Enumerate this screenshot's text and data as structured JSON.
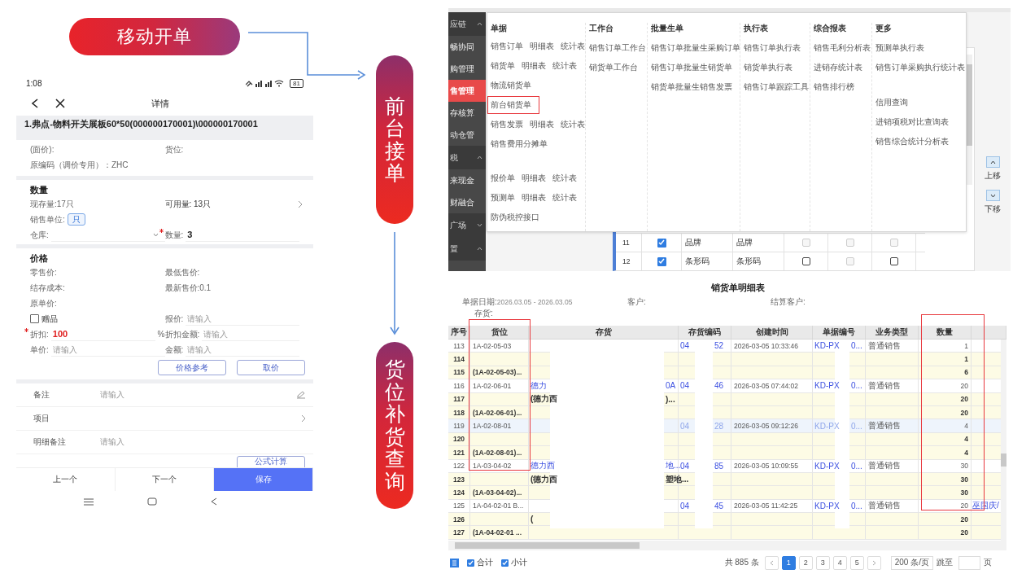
{
  "banner": {
    "title": "移动开单"
  },
  "pills": [
    {
      "text": "前台接单"
    },
    {
      "text": "货位补货查询"
    }
  ],
  "phone": {
    "status_bar": {
      "time": "1:08",
      "battery": "81"
    },
    "nav": {
      "title": "详情"
    },
    "product_title": "1.弗点-物料开关展板60*50(000000170001)\\000000170001",
    "info_rows": [
      {
        "cells": [
          {
            "kind": "text",
            "label": "(面价):"
          },
          {
            "kind": "text",
            "label": "货位:"
          }
        ]
      },
      {
        "cells": [
          {
            "kind": "text",
            "label": "原编码（调价专用）：",
            "value": "ZHC"
          }
        ]
      }
    ],
    "sections": [
      {
        "title": "数量",
        "rows": [
          {
            "cells": [
              {
                "kind": "text",
                "label": "现存量:",
                "value": "17只"
              },
              {
                "kind": "link",
                "label": "可用量:",
                "value": "13只"
              }
            ]
          },
          {
            "cells": [
              {
                "kind": "chip",
                "label": "销售单位:",
                "value": "只"
              }
            ]
          },
          {
            "cells": [
              {
                "kind": "select",
                "label": "仓库:"
              },
              {
                "kind": "input",
                "label": "数量:",
                "value": "3",
                "required": true
              }
            ]
          }
        ]
      },
      {
        "title": "价格",
        "rows": [
          {
            "cells": [
              {
                "kind": "text",
                "label": "零售价:"
              },
              {
                "kind": "text",
                "label": "最低售价:"
              }
            ]
          },
          {
            "cells": [
              {
                "kind": "text",
                "label": "结存成本:"
              },
              {
                "kind": "text",
                "label": "最新售价:",
                "value": "0.1"
              }
            ]
          },
          {
            "cells": [
              {
                "kind": "text",
                "label": "原单价:"
              }
            ]
          },
          {
            "cells": [
              {
                "kind": "checkbox",
                "label": "赠品",
                "checked": false
              },
              {
                "kind": "input",
                "label": "报价:",
                "placeholder": "请输入",
                "required": false
              }
            ]
          },
          {
            "cells": [
              {
                "kind": "input",
                "label": "折扣:",
                "value": "100",
                "suffix": "%",
                "required": true,
                "color": "#e02020"
              },
              {
                "kind": "input",
                "label": "折扣金额:",
                "placeholder": "请输入",
                "required": false
              }
            ]
          },
          {
            "cells": [
              {
                "kind": "input",
                "label": "单价:",
                "placeholder": "请输入",
                "required": false
              },
              {
                "kind": "input",
                "label": "金额:",
                "placeholder": "请输入",
                "required": false
              }
            ]
          }
        ],
        "buttons": [
          "价格参考",
          "取价"
        ]
      }
    ],
    "list_rows": [
      {
        "kind": "note",
        "label": "备注",
        "placeholder": "请输入"
      },
      {
        "kind": "picker",
        "label": "项目"
      },
      {
        "kind": "text",
        "label": "明细备注",
        "placeholder": "请输入"
      }
    ],
    "formula_button": "公式计算",
    "bottom_buttons": [
      {
        "label": "上一个",
        "primary": false
      },
      {
        "label": "下一个",
        "primary": false
      },
      {
        "label": "保存",
        "primary": true
      }
    ]
  },
  "erp_menu": {
    "sidebar": [
      {
        "label": "应链",
        "kind": "group",
        "expanded": true,
        "selected": false
      },
      {
        "label": "畅协同",
        "kind": "item",
        "selected": false
      },
      {
        "label": "购管理",
        "kind": "item",
        "selected": false
      },
      {
        "label": "售管理",
        "kind": "item",
        "selected": true
      },
      {
        "label": "存核算",
        "kind": "item",
        "selected": false
      },
      {
        "label": "动仓管",
        "kind": "item",
        "selected": false
      },
      {
        "label": "税",
        "kind": "group",
        "expanded": true,
        "selected": false
      },
      {
        "label": "来现金",
        "kind": "item",
        "selected": false
      },
      {
        "label": "财融合",
        "kind": "item",
        "selected": false
      },
      {
        "label": "广场",
        "kind": "group",
        "expanded": false,
        "selected": false
      },
      {
        "label": "置",
        "kind": "group",
        "expanded": true,
        "selected": false
      }
    ],
    "columns": [
      {
        "title": "单据",
        "rows": [
          {
            "kind": "items",
            "items": [
              "销售订单",
              "明细表",
              "统计表"
            ],
            "boxed": false
          },
          {
            "kind": "items",
            "items": [
              "销货单",
              "明细表",
              "统计表"
            ],
            "boxed": false
          },
          {
            "kind": "items",
            "items": [
              "物流销货单"
            ],
            "boxed": false
          },
          {
            "kind": "items",
            "items": [
              "前台销货单"
            ],
            "boxed": true
          },
          {
            "kind": "items",
            "items": [
              "销售发票",
              "明细表",
              "统计表"
            ],
            "boxed": false
          },
          {
            "kind": "items",
            "items": [
              "销售费用分摊单"
            ],
            "boxed": false
          },
          {
            "kind": "gap"
          },
          {
            "kind": "items",
            "items": [
              "报价单",
              "明细表",
              "统计表"
            ],
            "boxed": false
          },
          {
            "kind": "items",
            "items": [
              "预测单",
              "明细表",
              "统计表"
            ],
            "boxed": false
          },
          {
            "kind": "items",
            "items": [
              "防伪税控接口"
            ],
            "boxed": false
          }
        ]
      },
      {
        "title": "工作台",
        "rows": [
          {
            "kind": "items",
            "items": [
              "销售订单工作台"
            ],
            "boxed": false
          },
          {
            "kind": "items",
            "items": [
              "销货单工作台"
            ],
            "boxed": false
          }
        ]
      },
      {
        "title": "批量生单",
        "rows": [
          {
            "kind": "items",
            "items": [
              "销售订单批量生采购订单"
            ],
            "boxed": false
          },
          {
            "kind": "items",
            "items": [
              "销售订单批量生销货单"
            ],
            "boxed": false
          },
          {
            "kind": "items",
            "items": [
              "销货单批量生销售发票"
            ],
            "boxed": false
          }
        ]
      },
      {
        "title": "执行表",
        "rows": [
          {
            "kind": "items",
            "items": [
              "销售订单执行表"
            ],
            "boxed": false
          },
          {
            "kind": "items",
            "items": [
              "销货单执行表"
            ],
            "boxed": false
          },
          {
            "kind": "items",
            "items": [
              "销售订单跟踪工具"
            ],
            "boxed": false
          }
        ]
      },
      {
        "title": "综合报表",
        "rows": [
          {
            "kind": "items",
            "items": [
              "销售毛利分析表"
            ],
            "boxed": false
          },
          {
            "kind": "items",
            "items": [
              "进销存统计表"
            ],
            "boxed": false
          },
          {
            "kind": "items",
            "items": [
              "销售排行榜"
            ],
            "boxed": false
          }
        ]
      },
      {
        "title": "更多",
        "rows": [
          {
            "kind": "items",
            "items": [
              "预测单执行表"
            ],
            "boxed": false
          },
          {
            "kind": "items",
            "items": [
              "销售订单采购执行统计表"
            ],
            "boxed": false
          },
          {
            "kind": "gap"
          },
          {
            "kind": "items",
            "items": [
              "信用查询"
            ],
            "boxed": false
          },
          {
            "kind": "items",
            "items": [
              "进销项税对比查询表"
            ],
            "boxed": false
          },
          {
            "kind": "items",
            "items": [
              "销售综合统计分析表"
            ],
            "boxed": false
          }
        ]
      }
    ],
    "field_rows": [
      {
        "no": "11",
        "checked": true,
        "name": "品牌",
        "alias": "品牌",
        "flags": [
          {
            "checked": false,
            "disabled": true
          },
          {
            "checked": false,
            "disabled": true
          },
          {
            "checked": false,
            "disabled": true
          }
        ]
      },
      {
        "no": "12",
        "checked": true,
        "name": "条形码",
        "alias": "条形码",
        "flags": [
          {
            "checked": false,
            "disabled": false
          },
          {
            "checked": false,
            "disabled": true
          },
          {
            "checked": false,
            "disabled": false
          }
        ]
      }
    ],
    "move_buttons": [
      "上移",
      "下移"
    ]
  },
  "report": {
    "title": "销货单明细表",
    "filters": [
      {
        "label": "单据日期:",
        "value": "2026.03.05 - 2026.03.05"
      },
      {
        "label": "客户:"
      },
      {
        "label": "结算客户:"
      },
      {
        "label": "存货:"
      }
    ],
    "columns": [
      "序号",
      "货位",
      "存货",
      "存货编码",
      "创建时间",
      "单据编号",
      "业务类型",
      "数量"
    ],
    "rows": [
      {
        "no": "113",
        "kind": "detail",
        "selected": false,
        "location": "1A-02-05-03",
        "code": [
          "04",
          "52"
        ],
        "created": "2026-03-05 10:33:46",
        "doc": [
          "KD-PX",
          "0..."
        ],
        "type": "普通销售",
        "qty": "1"
      },
      {
        "no": "114",
        "kind": "subtotal",
        "selected": false,
        "qty": "1"
      },
      {
        "no": "115",
        "kind": "subtotal",
        "selected": false,
        "location": "(1A-02-05-03)...",
        "qty": "6"
      },
      {
        "no": "116",
        "kind": "detail",
        "selected": false,
        "location": "1A-02-06-01",
        "item": [
          "德力",
          "0A"
        ],
        "code": [
          "04",
          "46"
        ],
        "created": "2026-03-05 07:44:02",
        "doc": [
          "KD-PX",
          "0..."
        ],
        "type": "普通销售",
        "qty": "20"
      },
      {
        "no": "117",
        "kind": "subtotal",
        "selected": false,
        "item": [
          "(德力西",
          ")..."
        ],
        "qty": "20"
      },
      {
        "no": "118",
        "kind": "subtotal",
        "selected": false,
        "location": "(1A-02-06-01)...",
        "qty": "20"
      },
      {
        "no": "119",
        "kind": "detail",
        "selected": true,
        "location": "1A-02-08-01",
        "code": [
          "04",
          "28"
        ],
        "created": "2026-03-05 09:12:26",
        "doc": [
          "KD-PX",
          "0..."
        ],
        "type": "普通销售",
        "qty": "4"
      },
      {
        "no": "120",
        "kind": "subtotal",
        "selected": false,
        "qty": "4"
      },
      {
        "no": "121",
        "kind": "subtotal",
        "selected": false,
        "location": "(1A-02-08-01)...",
        "qty": "4"
      },
      {
        "no": "122",
        "kind": "detail",
        "selected": false,
        "location": "1A-03-04-02",
        "item": [
          "德力西",
          "地..."
        ],
        "code": [
          "04",
          "85"
        ],
        "created": "2026-03-05 10:09:55",
        "doc": [
          "KD-PX",
          "0..."
        ],
        "type": "普通销售",
        "qty": "30"
      },
      {
        "no": "123",
        "kind": "subtotal",
        "selected": false,
        "item": [
          "(德力西",
          "塑地..."
        ],
        "qty": "30"
      },
      {
        "no": "124",
        "kind": "subtotal",
        "selected": false,
        "location": "(1A-03-04-02)...",
        "qty": "30"
      },
      {
        "no": "125",
        "kind": "detail",
        "selected": false,
        "location": "1A-04-02-01 B...",
        "code": [
          "04",
          "45"
        ],
        "created": "2026-03-05 11:42:25",
        "doc": [
          "KD-PX",
          "0..."
        ],
        "type": "普通销售",
        "qty": "20",
        "extra": "巫国庆/"
      },
      {
        "no": "126",
        "kind": "subtotal",
        "selected": false,
        "item": [
          "("
        ],
        "qty": "20"
      },
      {
        "no": "127",
        "kind": "subtotal",
        "selected": false,
        "location": "(1A-04-02-01 ...",
        "qty": "20"
      }
    ],
    "totals": [
      {
        "label": "合计",
        "checked": true
      },
      {
        "label": "小计",
        "checked": true
      }
    ],
    "pagination": {
      "total": "共 885 条",
      "pages": [
        {
          "label": "1",
          "selected": true
        },
        {
          "label": "2",
          "selected": false
        },
        {
          "label": "3",
          "selected": false
        },
        {
          "label": "4",
          "selected": false
        },
        {
          "label": "5",
          "selected": false
        }
      ],
      "page_size": "200 条/页",
      "jump_label": "跳至",
      "page_suffix": "页"
    }
  }
}
